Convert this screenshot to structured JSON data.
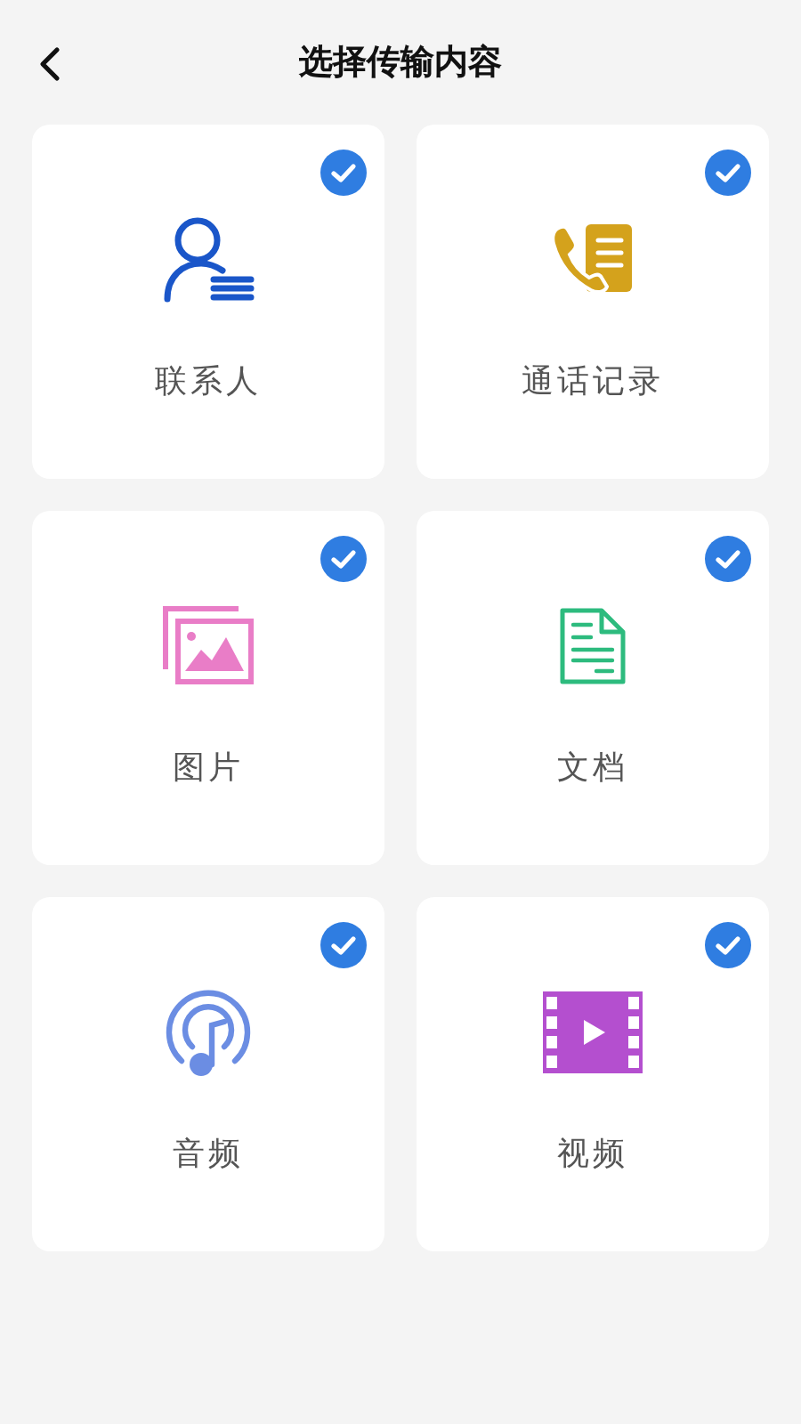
{
  "header": {
    "title": "选择传输内容"
  },
  "items": [
    {
      "kind": "contacts",
      "label": "联系人",
      "checked": true
    },
    {
      "kind": "calls",
      "label": "通话记录",
      "checked": true
    },
    {
      "kind": "pictures",
      "label": "图片",
      "checked": true
    },
    {
      "kind": "documents",
      "label": "文档",
      "checked": true
    },
    {
      "kind": "audio",
      "label": "音频",
      "checked": true
    },
    {
      "kind": "video",
      "label": "视频",
      "checked": true
    }
  ]
}
